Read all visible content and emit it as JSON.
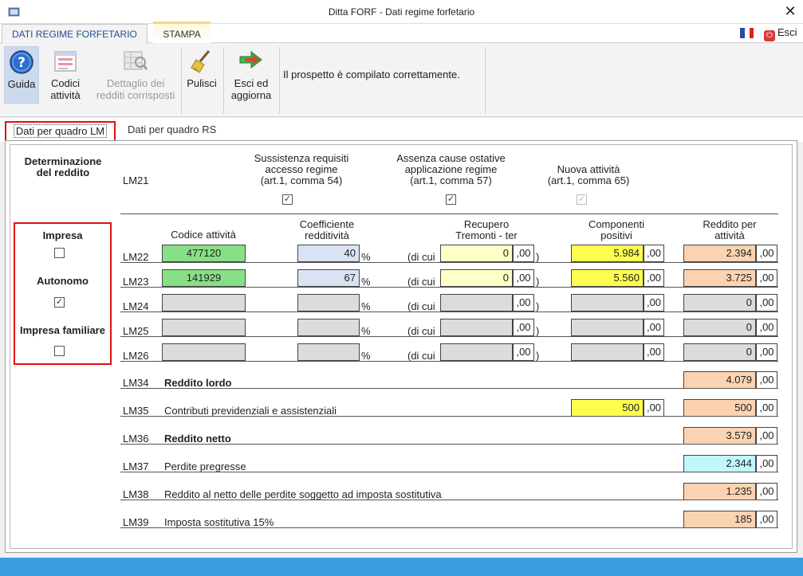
{
  "window": {
    "title": "Ditta FORF - Dati regime forfetario"
  },
  "ribbon_tabs": [
    "DATI REGIME FORFETARIO",
    "STAMPA"
  ],
  "esci_label": "Esci",
  "ribbon": {
    "guida": "Guida",
    "codici_1": "Codici",
    "codici_2": "attività",
    "dettaglio_1": "Dettaglio dei",
    "dettaglio_2": "redditi corrisposti",
    "pulisci": "Pulisci",
    "esci_agg_1": "Esci ed",
    "esci_agg_2": "aggiorna",
    "message": "Il prospetto è compilato correttamente."
  },
  "inner_tabs": [
    "Dati per quadro LM",
    "Dati per quadro RS"
  ],
  "left": {
    "heading_1": "Determinazione",
    "heading_2": "del reddito",
    "impresa": "Impresa",
    "impresa_checked": false,
    "autonomo": "Autonomo",
    "autonomo_checked": true,
    "familiare": "Impresa familiare",
    "familiare_checked": false
  },
  "lm21": {
    "code": "LM21",
    "col1": [
      "Sussistenza requisiti",
      "accesso regime",
      "(art.1, comma 54)"
    ],
    "col2": [
      "Assenza cause ostative",
      "applicazione regime",
      "(art.1, comma 57)"
    ],
    "col3": [
      "Nuova attività",
      "(art.1, comma 65)"
    ],
    "checks": [
      "✓",
      "✓",
      "✓"
    ]
  },
  "table_headers": {
    "codice": "Codice attività",
    "coeff_1": "Coefficiente",
    "coeff_2": "redditività",
    "recupero_1": "Recupero",
    "recupero_2": "Tremonti - ter",
    "componenti_1": "Componenti",
    "componenti_2": "positivi",
    "reddito_1": "Reddito per",
    "reddito_2": "attività"
  },
  "symbols": {
    "percent": "%",
    "dicui": "(di cui",
    "close_paren": ")",
    "decimals": ",00"
  },
  "rows": [
    {
      "code": "LM22",
      "codice": "477120",
      "coeff": "40",
      "recupero": "0",
      "componenti": "5.984",
      "reddito": "2.394"
    },
    {
      "code": "LM23",
      "codice": "141929",
      "coeff": "67",
      "recupero": "0",
      "componenti": "5.560",
      "reddito": "3.725"
    },
    {
      "code": "LM24",
      "codice": "",
      "coeff": "",
      "recupero": "",
      "componenti": "",
      "reddito": "0"
    },
    {
      "code": "LM25",
      "codice": "",
      "coeff": "",
      "recupero": "",
      "componenti": "",
      "reddito": "0"
    },
    {
      "code": "LM26",
      "codice": "",
      "coeff": "",
      "recupero": "",
      "componenti": "",
      "reddito": "0"
    }
  ],
  "summary": [
    {
      "code": "LM34",
      "label": "Reddito lordo",
      "value": "4.079"
    },
    {
      "code": "LM35",
      "label": "Contributi previdenziali e assistenziali",
      "side": "500",
      "value": "500"
    },
    {
      "code": "LM36",
      "label": "Reddito netto",
      "value": "3.579"
    },
    {
      "code": "LM37",
      "label": "Perdite pregresse",
      "value": "2.344"
    },
    {
      "code": "LM38",
      "label": "Reddito al netto delle perdite soggetto ad imposta sostitutiva",
      "value": "1.235"
    },
    {
      "code": "LM39",
      "label": "Imposta sostitutiva 15%",
      "value": "185"
    }
  ],
  "colors": {
    "accent": "#1e4f8f",
    "highlight_red": "#e01010",
    "status_bar": "#3a9cdf"
  }
}
